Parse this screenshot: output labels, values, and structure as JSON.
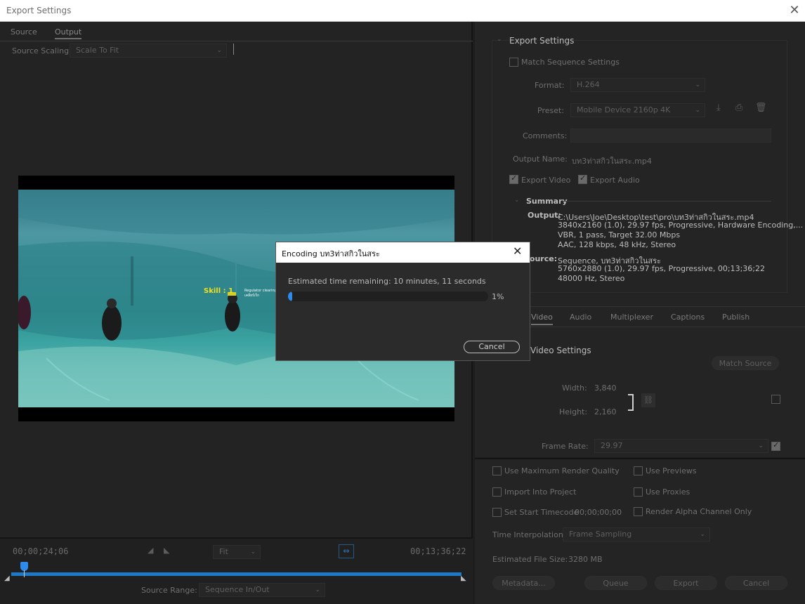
{
  "window": {
    "title": "Export Settings",
    "close_icon": "close-icon"
  },
  "left_tabs": [
    {
      "label": "Source"
    },
    {
      "label": "Output"
    }
  ],
  "source_scaling": {
    "label": "Source Scaling",
    "value": "Scale To Fit"
  },
  "video_overlay": {
    "skill": "Skill : 1",
    "caption": "Regulator clearing\nเคลียร์เร็ก"
  },
  "timeline": {
    "current_time": "00;00;24;06",
    "end_time": "00;13;36;22",
    "zoom": "Fit",
    "source_range_label": "Source Range:",
    "source_range_value": "Sequence In/Out"
  },
  "export_settings": {
    "section_title": "Export Settings",
    "match_sequence": "Match Sequence Settings",
    "format_label": "Format:",
    "format_value": "H.264",
    "preset_label": "Preset:",
    "preset_value": "Mobile Device 2160p 4K",
    "comments_label": "Comments:",
    "output_name_label": "Output Name:",
    "output_name_value": "บท3ท่าสกิวในสระ.mp4",
    "export_video": "Export Video",
    "export_audio": "Export Audio"
  },
  "summary": {
    "title": "Summary",
    "output_label": "Output:",
    "output_lines": [
      "C:\\Users\\Joe\\Desktop\\test\\pro\\บท3ท่าสกิวในสระ.mp4",
      "3840x2160 (1.0), 29.97 fps, Progressive, Hardware Encoding,...",
      "VBR, 1 pass, Target 32.00 Mbps",
      "AAC, 128 kbps, 48 kHz, Stereo"
    ],
    "source_label": "Source:",
    "source_lines": [
      "Sequence, บท3ท่าสกิวในสระ",
      "5760x2880 (1.0), 29.97 fps, Progressive, 00;13;36;22",
      "48000 Hz, Stereo"
    ]
  },
  "right_tabs": [
    {
      "label": "Video"
    },
    {
      "label": "Audio"
    },
    {
      "label": "Multiplexer"
    },
    {
      "label": "Captions"
    },
    {
      "label": "Publish"
    }
  ],
  "video_settings": {
    "title": "Video Settings",
    "match_source": "Match Source",
    "width_label": "Width:",
    "width_value": "3,840",
    "height_label": "Height:",
    "height_value": "2,160",
    "frame_rate_label": "Frame Rate:",
    "frame_rate_value": "29.97"
  },
  "options": {
    "max_render": "Use Maximum Render Quality",
    "use_previews": "Use Previews",
    "import_project": "Import Into Project",
    "use_proxies": "Use Proxies",
    "set_start_tc": "Set Start Timecode",
    "start_tc_value": "00;00;00;00",
    "render_alpha": "Render Alpha Channel Only",
    "time_interp_label": "Time Interpolation:",
    "time_interp_value": "Frame Sampling",
    "file_size_label": "Estimated File Size:",
    "file_size_value": "3280 MB"
  },
  "buttons": {
    "metadata": "Metadata...",
    "queue": "Queue",
    "export": "Export",
    "cancel": "Cancel"
  },
  "encoding_dialog": {
    "title": "Encoding บท3ท่าสกิวในสระ",
    "eta": "Estimated time remaining: 10 minutes, 11 seconds",
    "progress": 0.01,
    "percent": "1%",
    "cancel": "Cancel"
  }
}
